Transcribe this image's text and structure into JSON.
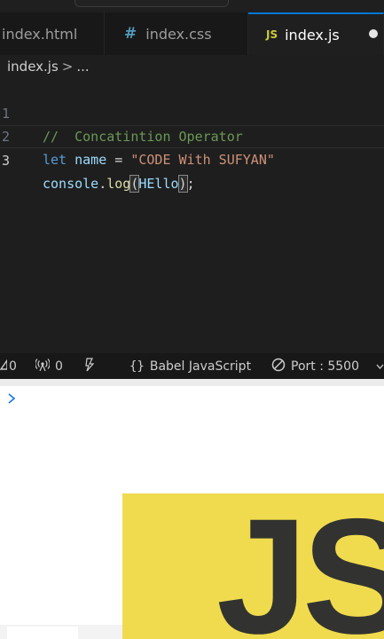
{
  "tabs": [
    {
      "label": "index.html",
      "icon": "html-file-icon"
    },
    {
      "label": "index.css",
      "icon": "css-file-icon",
      "glyph": "#"
    },
    {
      "label": "index.js",
      "icon": "js-file-icon",
      "glyph": "JS",
      "active": true,
      "unsaved": true
    }
  ],
  "breadcrumb": {
    "file": "index.js",
    "separator": ">",
    "more": "..."
  },
  "code": {
    "lines": [
      {
        "number": "1",
        "comment": "//  Concatintion Operator"
      },
      {
        "number": "2",
        "keyword": "let",
        "variable": "name",
        "operator": " = ",
        "string": "\"CODE With SUFYAN\""
      },
      {
        "number": "3",
        "object": "console",
        "dot": ".",
        "method": "log",
        "open": "(",
        "arg": "HEllo",
        "close": ")",
        "end": ";"
      }
    ]
  },
  "statusbar": {
    "errors": "0",
    "warnings": "0",
    "language": "Babel JavaScript",
    "port": "Port : 5500"
  },
  "console": {
    "prompt": ">"
  },
  "logo": {
    "text": "JS",
    "background": "#f0db4f",
    "color": "#323330"
  },
  "colors": {
    "accent": "#0078d4",
    "editor_bg": "#1e1e1e"
  }
}
